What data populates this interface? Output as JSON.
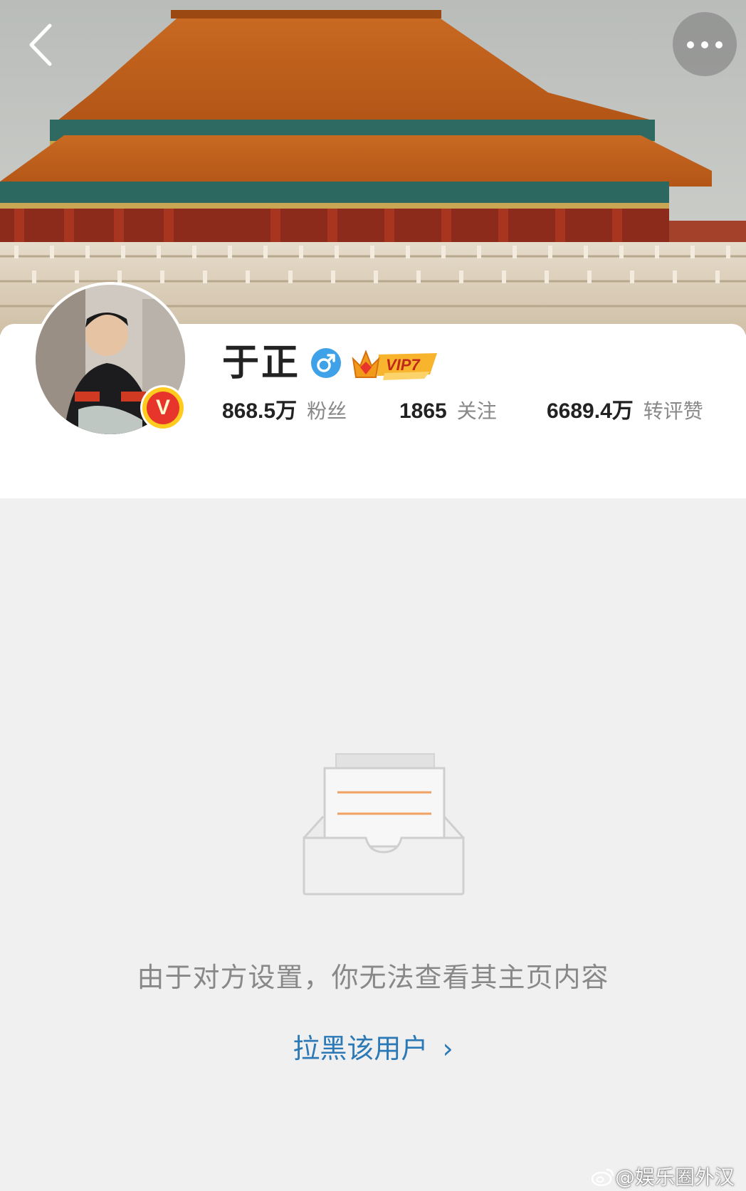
{
  "profile": {
    "name": "于正",
    "vip_level": "VIP7",
    "verified_badge": "V",
    "gender_symbol": "♂"
  },
  "stats": [
    {
      "value": "868.5万",
      "label": "粉丝"
    },
    {
      "value": "1865",
      "label": "关注"
    },
    {
      "value": "6689.4万",
      "label": "转评赞"
    }
  ],
  "empty_state": {
    "message": "由于对方设置，你无法查看其主页内容",
    "block_link": "拉黑该用户",
    "block_link_arrow": "›"
  },
  "watermark": "@娱乐圈外汉",
  "icons": {
    "back": "back-arrow-icon",
    "more": "more-dots-icon",
    "gender": "male-icon",
    "vip": "vip-crown-icon",
    "empty": "empty-box-icon",
    "weibo": "weibo-logo-icon"
  },
  "colors": {
    "accent_link": "#2b79b6",
    "gender_blue": "#3fa1e8",
    "verified_red": "#e8352b",
    "vip_gold": "#f5a524",
    "empty_line": "#f0a060"
  }
}
